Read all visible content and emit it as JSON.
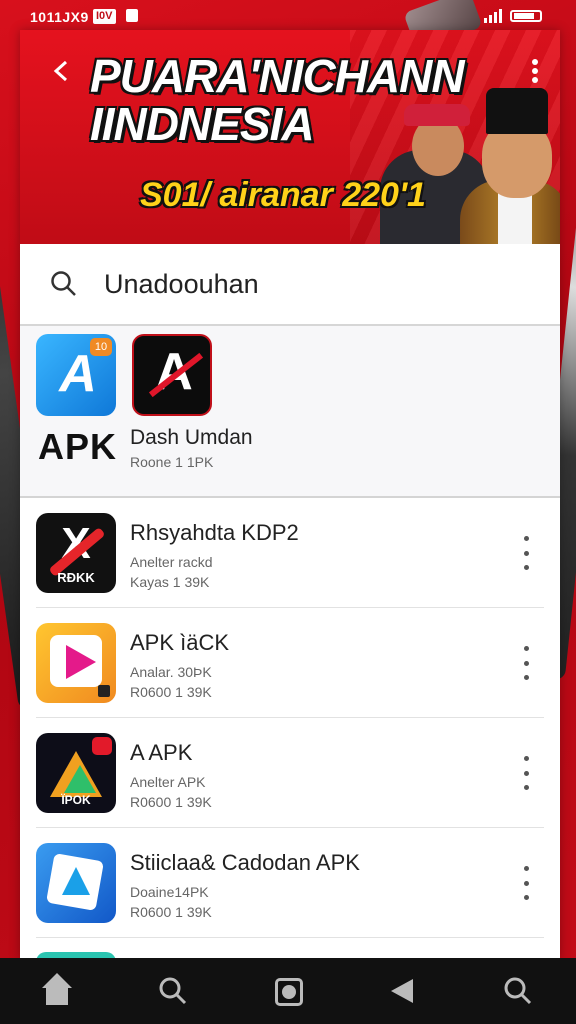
{
  "status_bar": {
    "time": "1011JX9",
    "badge": "I0V",
    "accent": "#c0101a"
  },
  "banner": {
    "title_line1": "PUARA'NICHANN",
    "title_line2": "IINDNESIA",
    "subtitle": "S01/ airanar 220'1",
    "back_icon": "arrow-left-icon",
    "menu_icon": "more-vert-icon",
    "background": "#d8101c"
  },
  "search": {
    "value": "Unadoouhan",
    "icon": "search-icon"
  },
  "featured": {
    "apk_badge": "10",
    "apk_label": "APK",
    "dash_title": "Dash Umdan",
    "dash_subtitle": "Roone 1 1PK"
  },
  "apps": [
    {
      "name": "Rhsyahdta KDP2",
      "line1": "Anelter rackd",
      "line2": "Kayas 1 39K",
      "icon_text": "RÐKK"
    },
    {
      "name": "APK ìäCK",
      "line1": "Analar. 30ÞK",
      "line2": "R0600 1 39K"
    },
    {
      "name": "A APK",
      "line1": "Anelter APK",
      "line2": "R0600 1 39K",
      "icon_text": "ÏPOK"
    },
    {
      "name": "Stiiclaa& Cadodan APK",
      "line1": "Doaine14PK",
      "line2": "R0600 1 39K"
    }
  ],
  "nav": {
    "icons": [
      "home-icon",
      "search-icon",
      "camera-icon",
      "back-icon",
      "search-icon"
    ]
  }
}
